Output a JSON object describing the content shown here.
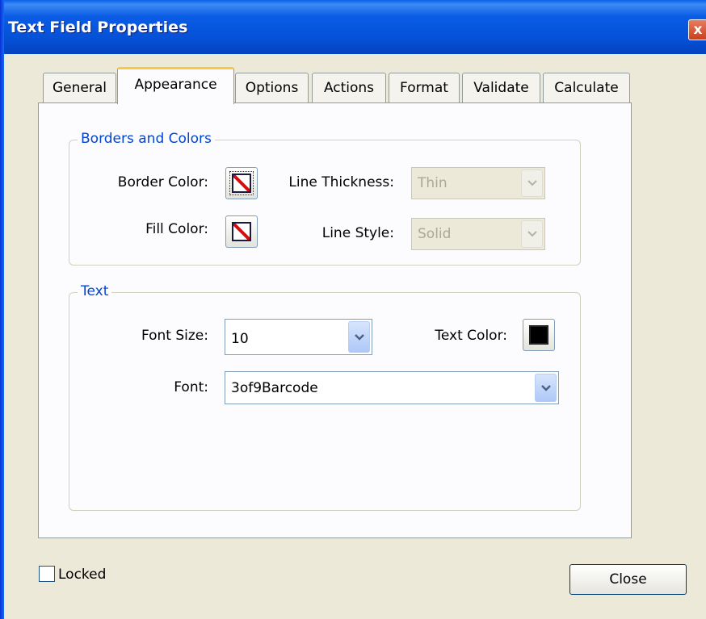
{
  "window": {
    "title": "Text Field Properties",
    "close_glyph": "x"
  },
  "tabs": [
    {
      "label": "General",
      "active": false
    },
    {
      "label": "Appearance",
      "active": true
    },
    {
      "label": "Options",
      "active": false
    },
    {
      "label": "Actions",
      "active": false
    },
    {
      "label": "Format",
      "active": false
    },
    {
      "label": "Validate",
      "active": false
    },
    {
      "label": "Calculate",
      "active": false
    }
  ],
  "borders_colors": {
    "title": "Borders and Colors",
    "border_color_label": "Border Color:",
    "border_color_icon": "no-color-swatch-icon",
    "line_thickness_label": "Line Thickness:",
    "line_thickness_value": "Thin",
    "fill_color_label": "Fill Color:",
    "fill_color_icon": "no-color-swatch-icon",
    "line_style_label": "Line Style:",
    "line_style_value": "Solid"
  },
  "text": {
    "title": "Text",
    "font_size_label": "Font Size:",
    "font_size_value": "10",
    "text_color_label": "Text Color:",
    "text_color": "#000000",
    "font_label": "Font:",
    "font_value": "3of9Barcode"
  },
  "footer": {
    "locked_label": "Locked",
    "locked_checked": false,
    "close_label": "Close"
  },
  "colors": {
    "titlebar": "#0551D8",
    "group_title": "#0046D5",
    "dialog_bg": "#ECE9D8",
    "active_tab_accent": "#FFC83C"
  }
}
